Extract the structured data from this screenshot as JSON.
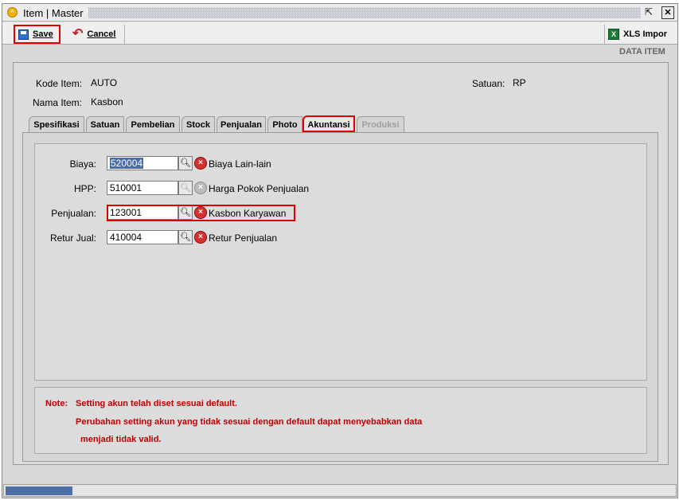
{
  "window": {
    "title": "Item | Master",
    "restore_icon": "restore-icon",
    "close_icon": "close-icon"
  },
  "toolbar": {
    "save_label": "Save",
    "cancel_label": "Cancel",
    "xls_label": "XLS Impor"
  },
  "section_label": "DATA ITEM",
  "header": {
    "kode_item_label": "Kode Item:",
    "kode_item_value": "AUTO",
    "nama_item_label": "Nama Item:",
    "nama_item_value": "Kasbon",
    "satuan_label": "Satuan:",
    "satuan_value": "RP"
  },
  "tabs": [
    {
      "label": "Spesifikasi",
      "state": "normal"
    },
    {
      "label": "Satuan",
      "state": "normal"
    },
    {
      "label": "Pembelian",
      "state": "normal"
    },
    {
      "label": "Stock",
      "state": "normal"
    },
    {
      "label": "Penjualan",
      "state": "normal"
    },
    {
      "label": "Photo",
      "state": "normal"
    },
    {
      "label": "Akuntansi",
      "state": "active"
    },
    {
      "label": "Produksi",
      "state": "disabled"
    }
  ],
  "accounts": [
    {
      "label": "Biaya:",
      "code": "520004",
      "name": "Biaya Lain-lain",
      "selected": true
    },
    {
      "label": "HPP:",
      "code": "510001",
      "name": "Harga Pokok Penjualan",
      "disabled": true
    },
    {
      "label": "Penjualan:",
      "code": "123001",
      "name": "Kasbon Karyawan",
      "highlighted": true
    },
    {
      "label": "Retur Jual:",
      "code": "410004",
      "name": "Retur Penjualan"
    }
  ],
  "note": {
    "prefix": "Note:",
    "line1": "Setting akun telah diset sesuai default.",
    "line2": "Perubahan setting akun yang tidak sesuai dengan default dapat menyebabkan data",
    "line3": "menjadi tidak valid."
  },
  "status": {
    "progress": 0.1
  },
  "colors": {
    "highlight": "#e00000",
    "note_text": "#c00000",
    "selection": "#4a6ea9"
  }
}
